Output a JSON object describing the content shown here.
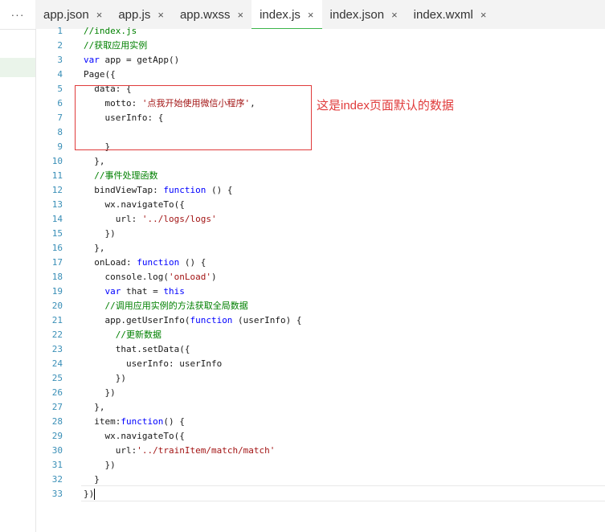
{
  "sidebar": {
    "more_label": "···"
  },
  "tabs": [
    {
      "label": "app.json",
      "close": "×"
    },
    {
      "label": "app.js",
      "close": "×"
    },
    {
      "label": "app.wxss",
      "close": "×"
    },
    {
      "label": "index.js",
      "close": "×",
      "active": true
    },
    {
      "label": "index.json",
      "close": "×"
    },
    {
      "label": "index.wxml",
      "close": "×"
    }
  ],
  "annotation": {
    "text": "这是index页面默认的数据",
    "color": "#e03b3b"
  },
  "editor": {
    "lines": [
      {
        "n": "1",
        "t": "//index.js"
      },
      {
        "n": "2",
        "t": "//获取应用实例"
      },
      {
        "n": "3",
        "t": "var app = getApp()"
      },
      {
        "n": "4",
        "t": "Page({"
      },
      {
        "n": "5",
        "t": "  data: {"
      },
      {
        "n": "6",
        "t": "    motto: '点我开始使用微信小程序',"
      },
      {
        "n": "7",
        "t": "    userInfo: {"
      },
      {
        "n": "8",
        "t": ""
      },
      {
        "n": "9",
        "t": "    }"
      },
      {
        "n": "10",
        "t": "  },"
      },
      {
        "n": "11",
        "t": "  //事件处理函数"
      },
      {
        "n": "12",
        "t": "  bindViewTap: function () {"
      },
      {
        "n": "13",
        "t": "    wx.navigateTo({"
      },
      {
        "n": "14",
        "t": "      url: '../logs/logs'"
      },
      {
        "n": "15",
        "t": "    })"
      },
      {
        "n": "16",
        "t": "  },"
      },
      {
        "n": "17",
        "t": "  onLoad: function () {"
      },
      {
        "n": "18",
        "t": "    console.log('onLoad')"
      },
      {
        "n": "19",
        "t": "    var that = this"
      },
      {
        "n": "20",
        "t": "    //调用应用实例的方法获取全局数据"
      },
      {
        "n": "21",
        "t": "    app.getUserInfo(function (userInfo) {"
      },
      {
        "n": "22",
        "t": "      //更新数据"
      },
      {
        "n": "23",
        "t": "      that.setData({"
      },
      {
        "n": "24",
        "t": "        userInfo: userInfo"
      },
      {
        "n": "25",
        "t": "      })"
      },
      {
        "n": "26",
        "t": "    })"
      },
      {
        "n": "27",
        "t": "  },"
      },
      {
        "n": "28",
        "t": "  item:function() {"
      },
      {
        "n": "29",
        "t": "    wx.navigateTo({"
      },
      {
        "n": "30",
        "t": "      url:'../trainItem/match/match'"
      },
      {
        "n": "31",
        "t": "    })"
      },
      {
        "n": "32",
        "t": "  }"
      },
      {
        "n": "33",
        "t": "})"
      }
    ]
  }
}
